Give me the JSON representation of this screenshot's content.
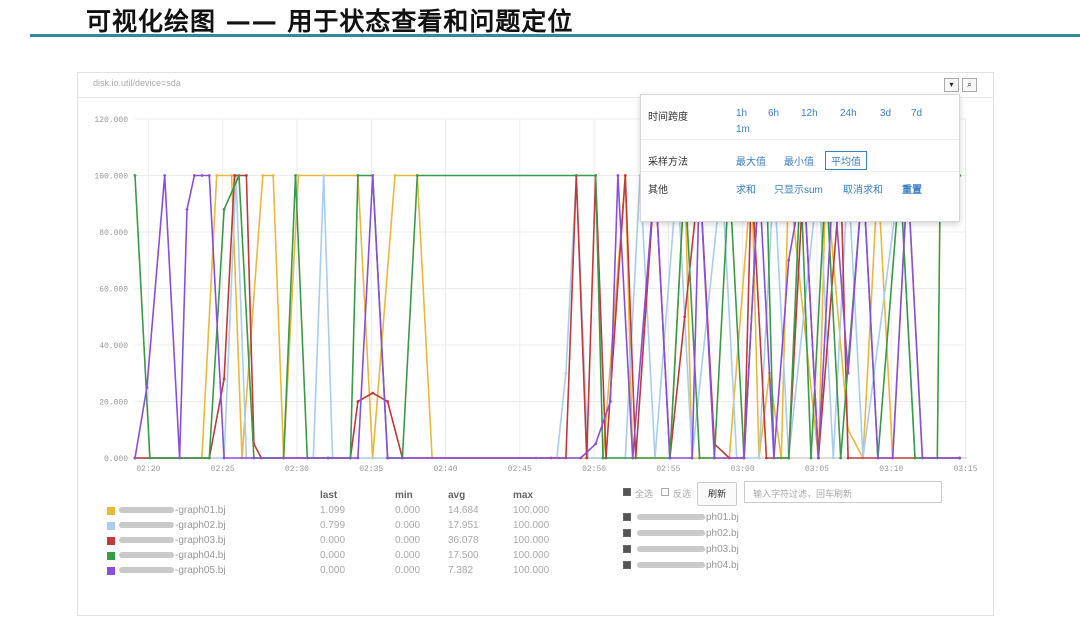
{
  "slide": {
    "title": "可视化绘图 —— 用于状态查看和问题定位"
  },
  "panel": {
    "path": "disk.io.util/device=sda",
    "dropdown_icon": "chevron-down-icon",
    "zoom_icon": "magnifier-icon"
  },
  "popover": {
    "time_label": "时间跨度",
    "time_options": [
      "1h",
      "6h",
      "12h",
      "24h",
      "3d",
      "7d",
      "1m"
    ],
    "sampling_label": "采样方法",
    "sampling_options": [
      "最大值",
      "最小值",
      "平均值"
    ],
    "sampling_selected": "平均值",
    "other_label": "其他",
    "other_options": [
      "求和",
      "只显示sum",
      "取消求和",
      "重置"
    ]
  },
  "chart_data": {
    "type": "line",
    "title": "",
    "xlabel": "",
    "ylabel": "",
    "ylim": [
      0,
      120
    ],
    "yticks": [
      "0.000",
      "20.000",
      "40.000",
      "60.000",
      "80.000",
      "100.000",
      "120.000"
    ],
    "xticks": [
      "02:20",
      "02:25",
      "02:30",
      "02:35",
      "02:40",
      "02:45",
      "02:50",
      "02:55",
      "03:00",
      "03:05",
      "03:10",
      "03:15"
    ],
    "grid": true,
    "series": [
      {
        "name": "-graph01.bj",
        "color": "#e8b93b",
        "points": [
          [
            0,
            0
          ],
          [
            4.5,
            0
          ],
          [
            5.5,
            100
          ],
          [
            6.5,
            100
          ],
          [
            7.2,
            0
          ],
          [
            8.6,
            100
          ],
          [
            9.3,
            100
          ],
          [
            10,
            0
          ],
          [
            11,
            100
          ],
          [
            15,
            100
          ],
          [
            16,
            0
          ],
          [
            17.5,
            100
          ],
          [
            19,
            100
          ],
          [
            20,
            0
          ],
          [
            27,
            0
          ],
          [
            28.5,
            0
          ],
          [
            31.5,
            0
          ],
          [
            33,
            100
          ],
          [
            33.5,
            0
          ],
          [
            36,
            0
          ],
          [
            37,
            100
          ],
          [
            37.5,
            0
          ],
          [
            40,
            0
          ],
          [
            41.5,
            100
          ],
          [
            42,
            0
          ],
          [
            42.7,
            30
          ],
          [
            43.5,
            0
          ],
          [
            44,
            100
          ],
          [
            46,
            0
          ],
          [
            46.5,
            100
          ],
          [
            48,
            10
          ],
          [
            49,
            0
          ],
          [
            50,
            100
          ],
          [
            51,
            0
          ],
          [
            52,
            100
          ],
          [
            53,
            0
          ],
          [
            55.5,
            0
          ]
        ]
      },
      {
        "name": "-graph02.bj",
        "color": "#aaccee",
        "points": [
          [
            0,
            0
          ],
          [
            6,
            0
          ],
          [
            6.8,
            100
          ],
          [
            7.5,
            0
          ],
          [
            12,
            0
          ],
          [
            12.7,
            100
          ],
          [
            13.3,
            0
          ],
          [
            27,
            0
          ],
          [
            28.4,
            0
          ],
          [
            29,
            30
          ],
          [
            29.7,
            100
          ],
          [
            30.5,
            0
          ],
          [
            33,
            0
          ],
          [
            34,
            100
          ],
          [
            35,
            0
          ],
          [
            36.5,
            100
          ],
          [
            37.5,
            0
          ],
          [
            39.5,
            100
          ],
          [
            40.5,
            0
          ],
          [
            42,
            0
          ],
          [
            43,
            100
          ],
          [
            44,
            0
          ],
          [
            46,
            100
          ],
          [
            47,
            0
          ],
          [
            48,
            100
          ],
          [
            49,
            0
          ],
          [
            51.5,
            100
          ],
          [
            52.5,
            0
          ],
          [
            55.5,
            0
          ]
        ]
      },
      {
        "name": "-graph03.bj",
        "color": "#c0393b",
        "points": [
          [
            0,
            0
          ],
          [
            5,
            0
          ],
          [
            6,
            28
          ],
          [
            6.7,
            100
          ],
          [
            7.5,
            100
          ],
          [
            8,
            5
          ],
          [
            8.5,
            0
          ],
          [
            13,
            0
          ],
          [
            14.5,
            0
          ],
          [
            15,
            20
          ],
          [
            16,
            23
          ],
          [
            17,
            20
          ],
          [
            18,
            0
          ],
          [
            28,
            0
          ],
          [
            29,
            0
          ],
          [
            29.7,
            100
          ],
          [
            30.4,
            0
          ],
          [
            31,
            100
          ],
          [
            31.7,
            0
          ],
          [
            33,
            100
          ],
          [
            33.7,
            0
          ],
          [
            35,
            100
          ],
          [
            36,
            0
          ],
          [
            37,
            50
          ],
          [
            38,
            100
          ],
          [
            39,
            5
          ],
          [
            40,
            0
          ],
          [
            41,
            0
          ],
          [
            41.5,
            100
          ],
          [
            42.5,
            0
          ],
          [
            44,
            0
          ],
          [
            45,
            100
          ],
          [
            46,
            0
          ],
          [
            47.5,
            100
          ],
          [
            48,
            0
          ],
          [
            55.5,
            0
          ]
        ]
      },
      {
        "name": "-graph04.bj",
        "color": "#3a9a48",
        "points": [
          [
            0,
            100
          ],
          [
            1,
            0
          ],
          [
            5,
            0
          ],
          [
            6,
            88
          ],
          [
            7,
            100
          ],
          [
            8,
            0
          ],
          [
            10,
            0
          ],
          [
            10.8,
            100
          ],
          [
            11.6,
            0
          ],
          [
            13,
            0
          ],
          [
            14.5,
            0
          ],
          [
            15,
            100
          ],
          [
            16,
            100
          ],
          [
            17,
            0
          ],
          [
            18,
            0
          ],
          [
            19,
            100
          ],
          [
            31,
            100
          ],
          [
            31.5,
            0
          ],
          [
            36,
            0
          ],
          [
            37,
            100
          ],
          [
            38,
            0
          ],
          [
            39,
            0
          ],
          [
            40,
            100
          ],
          [
            41,
            0
          ],
          [
            42,
            100
          ],
          [
            42.5,
            100
          ],
          [
            43,
            0
          ],
          [
            44,
            0
          ],
          [
            44.8,
            100
          ],
          [
            45.5,
            0
          ],
          [
            46.5,
            100
          ],
          [
            47.5,
            0
          ],
          [
            49,
            100
          ],
          [
            50,
            0
          ],
          [
            51.5,
            100
          ],
          [
            52.5,
            0
          ],
          [
            54,
            0
          ],
          [
            54.2,
            100
          ],
          [
            55.5,
            100
          ]
        ]
      },
      {
        "name": "-graph05.bj",
        "color": "#8a4fd8",
        "points": [
          [
            0,
            0
          ],
          [
            0.8,
            25
          ],
          [
            2,
            100
          ],
          [
            3,
            0
          ],
          [
            3.5,
            88
          ],
          [
            4,
            100
          ],
          [
            4.5,
            100
          ],
          [
            5,
            100
          ],
          [
            6,
            0
          ],
          [
            8,
            0
          ],
          [
            15,
            0
          ],
          [
            16,
            100
          ],
          [
            17,
            0
          ],
          [
            30,
            0
          ],
          [
            31,
            5
          ],
          [
            32,
            20
          ],
          [
            32.5,
            100
          ],
          [
            33.5,
            0
          ],
          [
            35,
            100
          ],
          [
            36,
            0
          ],
          [
            37.5,
            0
          ],
          [
            38,
            100
          ],
          [
            39,
            0
          ],
          [
            41,
            0
          ],
          [
            42,
            100
          ],
          [
            43,
            0
          ],
          [
            44,
            70
          ],
          [
            45,
            100
          ],
          [
            46,
            0
          ],
          [
            47,
            100
          ],
          [
            48,
            30
          ],
          [
            49,
            100
          ],
          [
            50,
            0
          ],
          [
            51,
            0
          ],
          [
            52,
            100
          ],
          [
            53,
            0
          ],
          [
            55.5,
            0
          ]
        ]
      }
    ]
  },
  "legend": {
    "headers": {
      "last": "last",
      "min": "min",
      "avg": "avg",
      "max": "max"
    },
    "rows": [
      {
        "name": "-graph01.bj",
        "color": "#e8b93b",
        "last": "1.099",
        "min": "0.000",
        "avg": "14.684",
        "max": "100.000"
      },
      {
        "name": "-graph02.bj",
        "color": "#aaccee",
        "last": "0.799",
        "min": "0.000",
        "avg": "17.951",
        "max": "100.000"
      },
      {
        "name": "-graph03.bj",
        "color": "#c0393b",
        "last": "0.000",
        "min": "0.000",
        "avg": "36.078",
        "max": "100.000"
      },
      {
        "name": "-graph04.bj",
        "color": "#3a9a48",
        "last": "0.000",
        "min": "0.000",
        "avg": "17.500",
        "max": "100.000"
      },
      {
        "name": "-graph05.bj",
        "color": "#8a4fd8",
        "last": "0.000",
        "min": "0.000",
        "avg": "7.382",
        "max": "100.000"
      }
    ]
  },
  "filter": {
    "select_all": "全选",
    "invert": "反选",
    "refresh": "刷新",
    "placeholder": "输入字符过滤，回车刷新",
    "hosts": [
      "ph01.bj",
      "ph02.bj",
      "ph03.bj",
      "ph04.bj"
    ]
  }
}
